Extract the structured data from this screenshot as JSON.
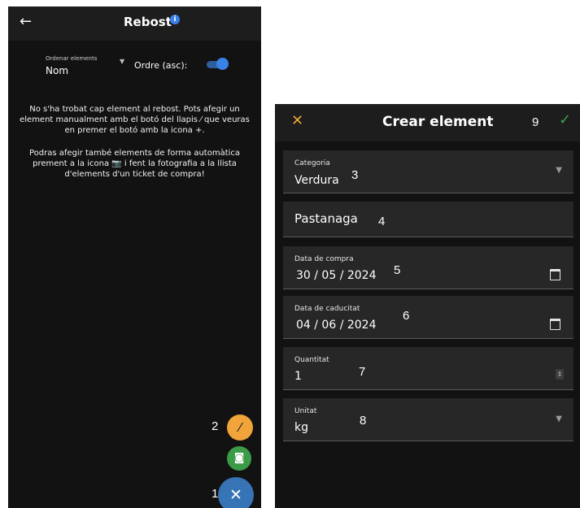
{
  "left_screen": {
    "title": "Rebost",
    "back_icon": "←",
    "info_icon": "i",
    "sort": {
      "label": "Ordenar elements",
      "value": "Nom",
      "arrow": "▼"
    },
    "order": {
      "label": "Ordre (asc):",
      "enabled": true
    },
    "empty_message": "No s'ha trobat cap element al rebost. Pots afegir un element manualment amb el botó del llapis ⁄ que veuras en premer el botó amb la icona +.",
    "auto_message": "Podras afegir també elements de forma automàtica prement a la icona 📷 i fent la fotografia a la llista d'elements d'un ticket de compra!",
    "fabs": {
      "pencil_icon": "⁄",
      "camera_icon": "◙",
      "close_icon": "✕"
    }
  },
  "right_screen": {
    "title": "Crear element",
    "close_icon": "✕",
    "confirm_icon": "✓",
    "fields": {
      "categoria": {
        "label": "Categoria",
        "value": "Verdura"
      },
      "nom": {
        "value": "Pastanaga"
      },
      "data_compra": {
        "label": "Data de compra",
        "value": "30 / 05 / 2024"
      },
      "data_caducitat": {
        "label": "Data de caducitat",
        "value": "04 / 06 / 2024"
      },
      "quantitat": {
        "label": "Quantitat",
        "value": "1"
      },
      "unitat": {
        "label": "Unitat",
        "value": "kg"
      }
    },
    "dropdown_arrow": "▼",
    "stepper_icon": "⇕"
  },
  "annotations": [
    "1",
    "2",
    "3",
    "4",
    "5",
    "6",
    "7",
    "8",
    "9"
  ],
  "colors": {
    "background": "#121212",
    "accent_orange": "#f0a43a",
    "accent_green": "#3b9b47",
    "accent_blue": "#3774b5",
    "info_blue": "#3a80e8"
  }
}
